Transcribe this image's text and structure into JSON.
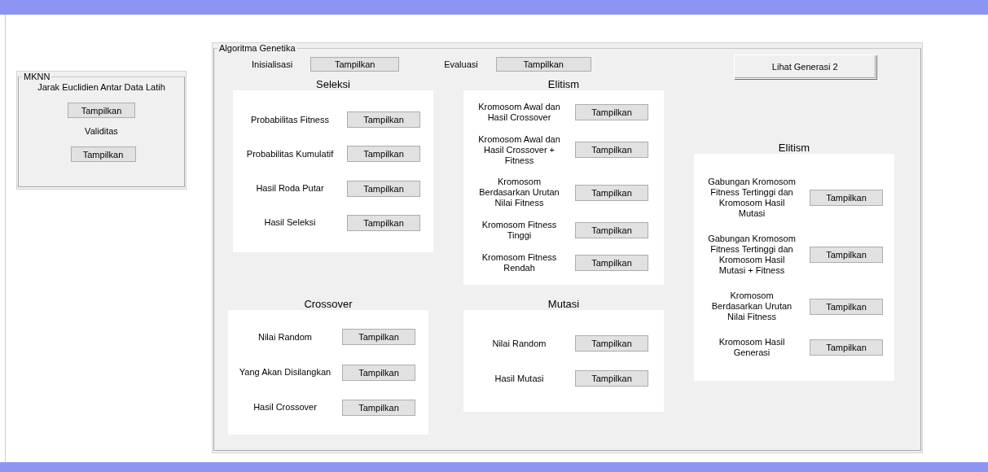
{
  "mknn_panel": {
    "title": "MKNN",
    "items": [
      {
        "kind": "label",
        "text": "Jarak Euclidien Antar Data Latih"
      },
      {
        "kind": "button",
        "text": "Tampilkan"
      },
      {
        "kind": "label",
        "text": "Validitas"
      },
      {
        "kind": "button",
        "text": "Tampilkan"
      }
    ]
  },
  "ga_panel": {
    "title": "Algoritma Genetika",
    "top_row": [
      {
        "label": "Inisialisasi",
        "button": "Tampilkan"
      },
      {
        "label": "Evaluasi",
        "button": "Tampilkan"
      }
    ],
    "generation_button": "Lihat Generasi 2",
    "columns": [
      [
        {
          "title": "Seleksi",
          "rows": [
            {
              "label": "Probabilitas Fitness",
              "button": "Tampilkan"
            },
            {
              "label": "Probabilitas Kumulatif",
              "button": "Tampilkan"
            },
            {
              "label": "Hasil Roda Putar",
              "button": "Tampilkan"
            },
            {
              "label": "Hasil Seleksi",
              "button": "Tampilkan"
            }
          ]
        },
        {
          "title": "Crossover",
          "rows": [
            {
              "label": "Nilai Random",
              "button": "Tampilkan"
            },
            {
              "label": "Yang Akan Disilangkan",
              "button": "Tampilkan"
            },
            {
              "label": "Hasil Crossover",
              "button": "Tampilkan"
            }
          ]
        }
      ],
      [
        {
          "title": "Elitism",
          "rows": [
            {
              "label": "Kromosom Awal dan Hasil Crossover",
              "button": "Tampilkan"
            },
            {
              "label": "Kromosom Awal dan Hasil Crossover + Fitness",
              "button": "Tampilkan"
            },
            {
              "label": "Kromosom Berdasarkan Urutan Nilai Fitness",
              "button": "Tampilkan"
            },
            {
              "label": "Kromosom Fitness Tinggi",
              "button": "Tampilkan"
            },
            {
              "label": "Kromosom Fitness Rendah",
              "button": "Tampilkan"
            }
          ]
        },
        {
          "title": "Mutasi",
          "rows": [
            {
              "label": "Nilai Random",
              "button": "Tampilkan"
            },
            {
              "label": "Hasil Mutasi",
              "button": "Tampilkan"
            }
          ]
        }
      ],
      [
        {
          "title": "Elitism",
          "rows": [
            {
              "label": "Gabungan Kromosom Fitness Tertinggi dan Kromosom Hasil Mutasi",
              "button": "Tampilkan"
            },
            {
              "label": "Gabungan Kromosom Fitness Tertinggi dan Kromosom Hasil Mutasi + Fitness",
              "button": "Tampilkan"
            },
            {
              "label": "Kromosom Berdasarkan Urutan Nilai Fitness",
              "button": "Tampilkan"
            },
            {
              "label": "Kromosom Hasil Generasi",
              "button": "Tampilkan"
            }
          ]
        }
      ]
    ]
  }
}
